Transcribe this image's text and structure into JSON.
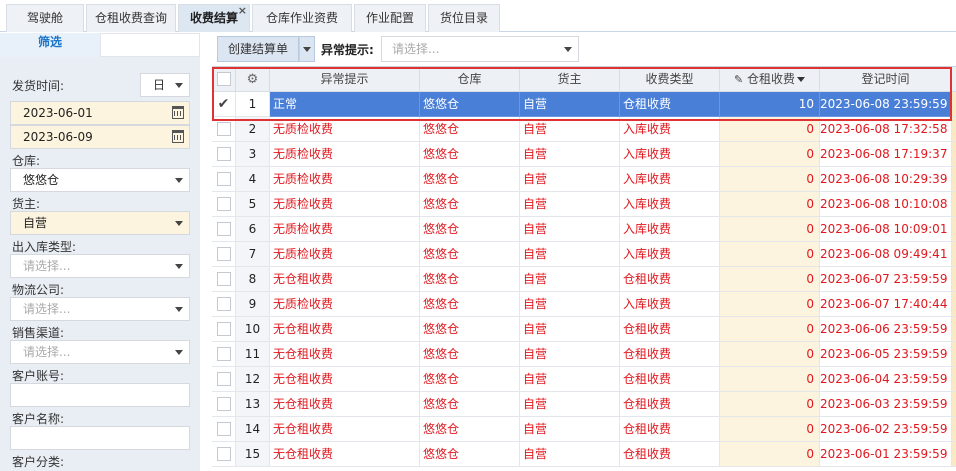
{
  "tabs": [
    {
      "label": "驾驶舱"
    },
    {
      "label": "仓租收费查询"
    },
    {
      "label": "收费结算"
    },
    {
      "label": "仓库作业资费"
    },
    {
      "label": "作业配置"
    },
    {
      "label": "货位目录"
    }
  ],
  "active_tab_close": "×",
  "filter": {
    "title": "筛选",
    "ship_time_label": "发货时间:",
    "ship_time_unit": "日",
    "date_from": "2023-06-01",
    "date_to": "2023-06-09",
    "warehouse_label": "仓库:",
    "warehouse_value": "悠悠仓",
    "owner_label": "货主:",
    "owner_value": "自营",
    "io_type_label": "出入库类型:",
    "io_type_placeholder": "请选择...",
    "logistics_label": "物流公司:",
    "logistics_placeholder": "请选择...",
    "channel_label": "销售渠道:",
    "channel_placeholder": "请选择...",
    "customer_account_label": "客户账号:",
    "customer_name_label": "客户名称:",
    "customer_category_label": "客户分类:"
  },
  "toolbar": {
    "create_label": "创建结算单",
    "exception_label": "异常提示:",
    "exception_placeholder": "请选择..."
  },
  "grid": {
    "headers": {
      "exception": "异常提示",
      "warehouse": "仓库",
      "owner": "货主",
      "fee_type": "收费类型",
      "rent_fee": "仓租收费",
      "reg_time": "登记时间"
    },
    "rows": [
      {
        "no": "1",
        "exception": "正常",
        "warehouse": "悠悠仓",
        "owner": "自营",
        "fee_type": "仓租收费",
        "rent_fee": "10",
        "reg_time": "2023-06-08 23:59:59"
      },
      {
        "no": "2",
        "exception": "无质检收费",
        "warehouse": "悠悠仓",
        "owner": "自营",
        "fee_type": "入库收费",
        "rent_fee": "0",
        "reg_time": "2023-06-08 17:32:58"
      },
      {
        "no": "3",
        "exception": "无质检收费",
        "warehouse": "悠悠仓",
        "owner": "自营",
        "fee_type": "入库收费",
        "rent_fee": "0",
        "reg_time": "2023-06-08 17:19:37"
      },
      {
        "no": "4",
        "exception": "无质检收费",
        "warehouse": "悠悠仓",
        "owner": "自营",
        "fee_type": "入库收费",
        "rent_fee": "0",
        "reg_time": "2023-06-08 10:29:39"
      },
      {
        "no": "5",
        "exception": "无质检收费",
        "warehouse": "悠悠仓",
        "owner": "自营",
        "fee_type": "入库收费",
        "rent_fee": "0",
        "reg_time": "2023-06-08 10:10:08"
      },
      {
        "no": "6",
        "exception": "无质检收费",
        "warehouse": "悠悠仓",
        "owner": "自营",
        "fee_type": "入库收费",
        "rent_fee": "0",
        "reg_time": "2023-06-08 10:09:01"
      },
      {
        "no": "7",
        "exception": "无质检收费",
        "warehouse": "悠悠仓",
        "owner": "自营",
        "fee_type": "入库收费",
        "rent_fee": "0",
        "reg_time": "2023-06-08 09:49:41"
      },
      {
        "no": "8",
        "exception": "无仓租收费",
        "warehouse": "悠悠仓",
        "owner": "自营",
        "fee_type": "仓租收费",
        "rent_fee": "0",
        "reg_time": "2023-06-07 23:59:59"
      },
      {
        "no": "9",
        "exception": "无质检收费",
        "warehouse": "悠悠仓",
        "owner": "自营",
        "fee_type": "入库收费",
        "rent_fee": "0",
        "reg_time": "2023-06-07 17:40:44"
      },
      {
        "no": "10",
        "exception": "无仓租收费",
        "warehouse": "悠悠仓",
        "owner": "自营",
        "fee_type": "仓租收费",
        "rent_fee": "0",
        "reg_time": "2023-06-06 23:59:59"
      },
      {
        "no": "11",
        "exception": "无仓租收费",
        "warehouse": "悠悠仓",
        "owner": "自营",
        "fee_type": "仓租收费",
        "rent_fee": "0",
        "reg_time": "2023-06-05 23:59:59"
      },
      {
        "no": "12",
        "exception": "无仓租收费",
        "warehouse": "悠悠仓",
        "owner": "自营",
        "fee_type": "仓租收费",
        "rent_fee": "0",
        "reg_time": "2023-06-04 23:59:59"
      },
      {
        "no": "13",
        "exception": "无仓租收费",
        "warehouse": "悠悠仓",
        "owner": "自营",
        "fee_type": "仓租收费",
        "rent_fee": "0",
        "reg_time": "2023-06-03 23:59:59"
      },
      {
        "no": "14",
        "exception": "无仓租收费",
        "warehouse": "悠悠仓",
        "owner": "自营",
        "fee_type": "仓租收费",
        "rent_fee": "0",
        "reg_time": "2023-06-02 23:59:59"
      },
      {
        "no": "15",
        "exception": "无仓租收费",
        "warehouse": "悠悠仓",
        "owner": "自营",
        "fee_type": "仓租收费",
        "rent_fee": "0",
        "reg_time": "2023-06-01 23:59:59"
      }
    ]
  },
  "colors": {
    "accent": "#1b75c9",
    "selected_row": "#4a7fd8",
    "error_text": "#e0181e",
    "highlight": "#e03232"
  }
}
